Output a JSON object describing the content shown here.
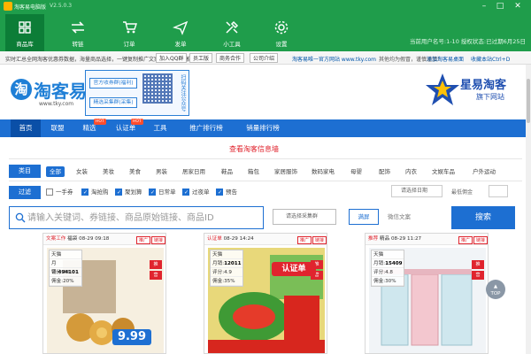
{
  "window": {
    "title": "淘客易电脑版",
    "version": "V2.5.0.3",
    "minimize": "–",
    "maximize": "□",
    "close": "✕"
  },
  "nav_tabs": [
    {
      "label": "商品库",
      "icon": "cube-stack-icon",
      "active": true
    },
    {
      "label": "转链",
      "icon": "swap-arrows-icon"
    },
    {
      "label": "订单",
      "icon": "cart-icon"
    },
    {
      "label": "发单",
      "icon": "paper-plane-icon"
    },
    {
      "label": "小工具",
      "icon": "tools-icon"
    },
    {
      "label": "设置",
      "icon": "gear-icon"
    }
  ],
  "sys_info": "当前用户名号:1-10 授权状态:已过期6月25日",
  "notice": {
    "text": "实时汇总全网淘客优惠券数据，海量商品选择，一键复制推广文案，淘客专属推广工具",
    "pill1": "加入QQ群",
    "pill2": "员工版",
    "pill3": "商务合作",
    "pill4": "公司介绍",
    "right1": "淘客易唯一官方网站 www.tky.com",
    "right2": "其他均为假冒，谨慎谨慎！",
    "right3": "添加淘客易桌面",
    "right4": "收藏本站Ctrl+D"
  },
  "header": {
    "logo_char": "淘",
    "logo_text": "淘客易",
    "logo_url": "www.tky.com",
    "qr_btn1": "官方收券群(福利)",
    "qr_btn2": "精选采集群(采集)",
    "qr_side": "扫码关注公众号",
    "brand_name": "星易淘客",
    "brand_sub": "旗下网站"
  },
  "main_nav": [
    {
      "label": "首页",
      "active": true
    },
    {
      "label": "联盟"
    },
    {
      "label": "精选",
      "hot": "HOT"
    },
    {
      "label": "认证单",
      "hot": "HOT"
    },
    {
      "label": "工具"
    },
    {
      "label": "推广排行榜"
    },
    {
      "label": "销量排行榜"
    }
  ],
  "category_link": "查看淘客信息墙",
  "category_label": "类目",
  "categories": [
    "全部",
    "女装",
    "美妆",
    "美食",
    "男装",
    "居家日用",
    "鞋品",
    "箱包",
    "家居服饰",
    "数码家电",
    "母婴",
    "配饰",
    "内衣",
    "文娱车品",
    "户外运动"
  ],
  "filter_label": "过滤",
  "filters": [
    {
      "label": "一手券",
      "checked": false
    },
    {
      "label": "淘抢购",
      "checked": true
    },
    {
      "label": "聚划算",
      "checked": true
    },
    {
      "label": "日常单",
      "checked": true
    },
    {
      "label": "过夜单",
      "checked": true
    },
    {
      "label": "预告",
      "checked": true
    }
  ],
  "sort_label": "请选择日期",
  "min_label": "最低佣金",
  "search": {
    "placeholder": "请输入关键词、券链接、商品原始链接、商品ID",
    "select_label": "请选择采集群",
    "toggle1": "满屏",
    "toggle2": "微信文案",
    "button": "搜索"
  },
  "products": [
    {
      "tag": "文案工作",
      "badge": "福袋",
      "time": "08-29 09:18",
      "chips": [
        "推广",
        "链接"
      ],
      "shop": "天猫",
      "monthly_label": "月销:",
      "monthly": "494101",
      "score_label": "评分:",
      "score": "4.9",
      "rate_label": "佣金:",
      "rate": "20%",
      "side": [
        "推",
        "营"
      ],
      "price": "9.99"
    },
    {
      "tag": "认证单",
      "badge": "",
      "time": "08-29 14:24",
      "chips": [
        "推广",
        "链接"
      ],
      "shop": "天猫",
      "monthly_label": "月销:",
      "monthly": "12011",
      "score_label": "评分:",
      "score": "4.9",
      "rate_label": "佣金:",
      "rate": "35%",
      "side": [
        "推",
        "营"
      ],
      "price": "认证单"
    },
    {
      "tag": "推荐",
      "badge": "精品",
      "time": "08-29 11:27",
      "chips": [
        "推广",
        "链接"
      ],
      "shop": "天猫",
      "monthly_label": "月销:",
      "monthly": "15409",
      "score_label": "评分:",
      "score": "4.8",
      "rate_label": "佣金:",
      "rate": "30%",
      "side": [
        "推",
        "营"
      ],
      "price": ""
    }
  ],
  "top_button": "TOP",
  "colors": {
    "primary_green": "#1f9d4b",
    "primary_blue": "#1d6fd2",
    "accent_red": "#e0242e"
  }
}
